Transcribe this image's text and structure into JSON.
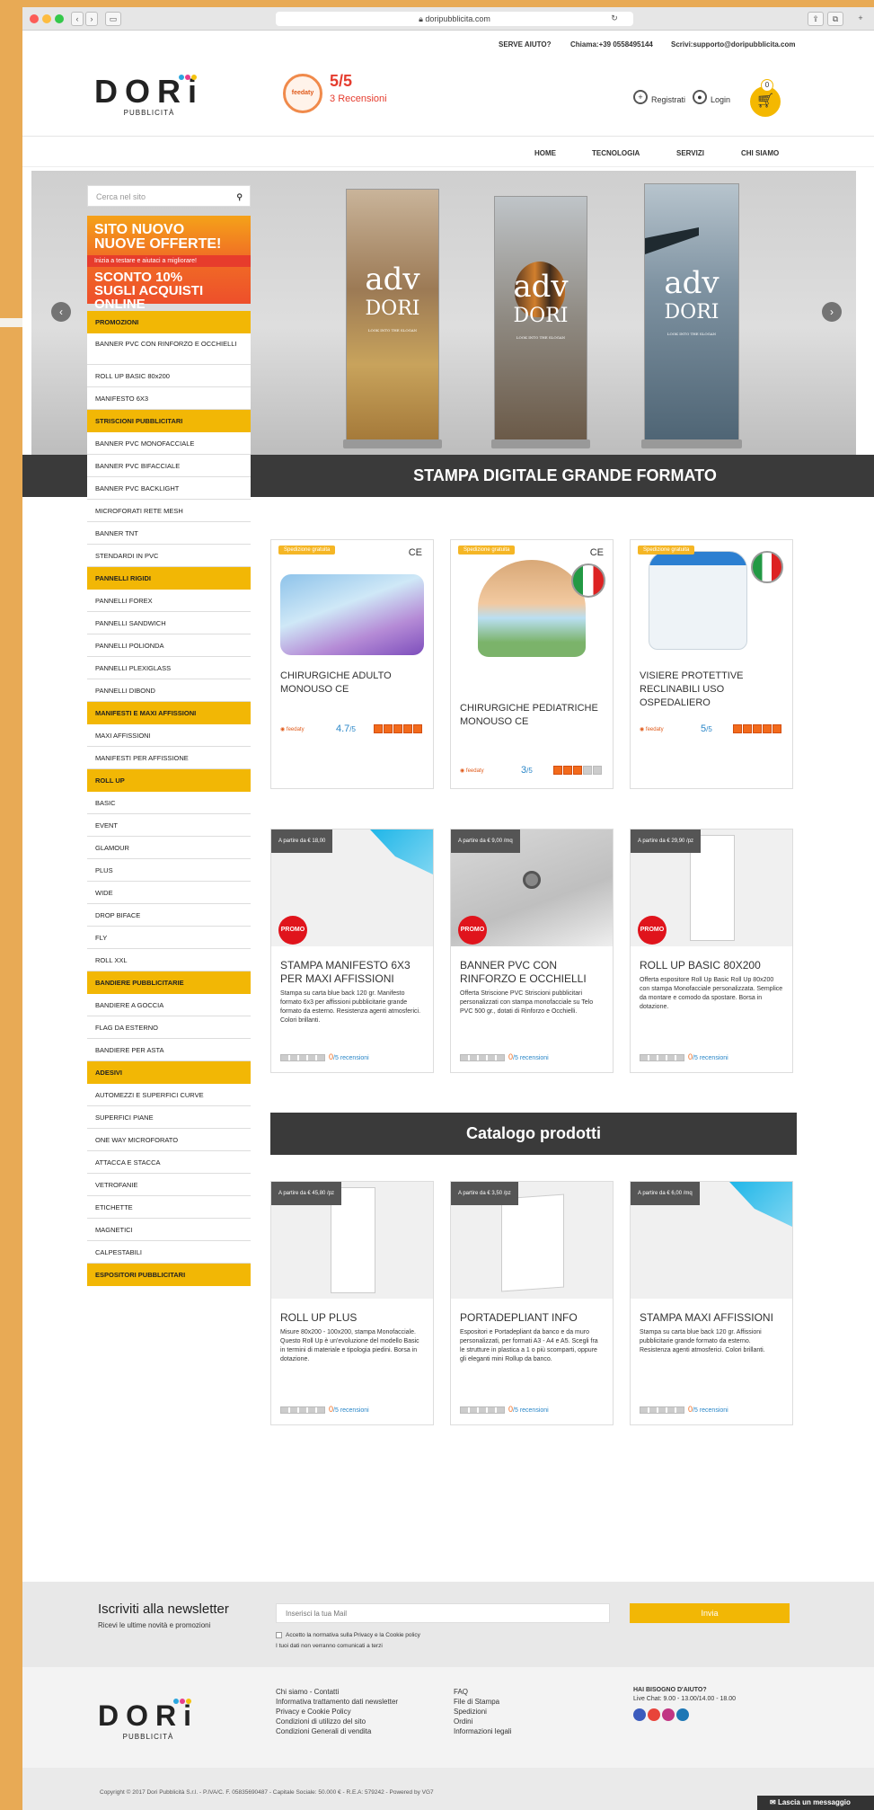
{
  "browser": {
    "url": "doripubblicita.com"
  },
  "topbar": {
    "help": "SERVE AIUTO?",
    "call": "Chiama:+39 0558495144",
    "write": "Scrivi:supporto@doripubblicita.com"
  },
  "brand": {
    "name": "DORi",
    "sub": "PUBBLICITÀ"
  },
  "reviews": {
    "badge": "feedaty",
    "score": "5/5",
    "count": "3",
    "label": "Recensioni"
  },
  "header": {
    "register": "Registrati",
    "login": "Login",
    "cart_count": "0"
  },
  "nav": [
    "HOME",
    "TECNOLOGIA",
    "SERVIZI",
    "CHI SIAMO"
  ],
  "search": {
    "placeholder": "Cerca nel sito"
  },
  "promo": {
    "line1": "SITO NUOVO",
    "line2": "NUOVE OFFERTE!",
    "line3": "Inizia a testare e aiutaci a migliorare!",
    "line4": "SCONTO 10%",
    "line5": "SUGLI ACQUISTI",
    "line6": "ONLINE"
  },
  "banner_text": {
    "adv": "adv",
    "dori": "DORI",
    "tag": "LOOK INTO THE SLOGAN"
  },
  "sidebar": [
    {
      "t": "h",
      "l": "PROMOZIONI"
    },
    {
      "t": "tall",
      "l": "BANNER PVC CON RINFORZO E OCCHIELLI"
    },
    {
      "t": "i",
      "l": "ROLL UP BASIC 80x200"
    },
    {
      "t": "i",
      "l": "MANIFESTO 6X3"
    },
    {
      "t": "h",
      "l": "STRISCIONI PUBBLICITARI"
    },
    {
      "t": "i",
      "l": "BANNER PVC MONOFACCIALE"
    },
    {
      "t": "i",
      "l": "BANNER PVC BIFACCIALE"
    },
    {
      "t": "i",
      "l": "BANNER PVC BACKLIGHT"
    },
    {
      "t": "i",
      "l": "MICROFORATI RETE MESH"
    },
    {
      "t": "i",
      "l": "BANNER TNT"
    },
    {
      "t": "i",
      "l": "STENDARDI IN PVC"
    },
    {
      "t": "h",
      "l": "PANNELLI RIGIDI"
    },
    {
      "t": "i",
      "l": "PANNELLI FOREX"
    },
    {
      "t": "i",
      "l": "PANNELLI SANDWICH"
    },
    {
      "t": "i",
      "l": "PANNELLI POLIONDA"
    },
    {
      "t": "i",
      "l": "PANNELLI PLEXIGLASS"
    },
    {
      "t": "i",
      "l": "PANNELLI DIBOND"
    },
    {
      "t": "h",
      "l": "MANIFESTI E MAXI AFFISSIONI"
    },
    {
      "t": "i",
      "l": "MAXI AFFISSIONI"
    },
    {
      "t": "i",
      "l": "MANIFESTI PER AFFISSIONE"
    },
    {
      "t": "h",
      "l": "ROLL UP"
    },
    {
      "t": "i",
      "l": "BASIC"
    },
    {
      "t": "i",
      "l": "EVENT"
    },
    {
      "t": "i",
      "l": "GLAMOUR"
    },
    {
      "t": "i",
      "l": "PLUS"
    },
    {
      "t": "i",
      "l": "WIDE"
    },
    {
      "t": "i",
      "l": "DROP BIFACE"
    },
    {
      "t": "i",
      "l": "FLY"
    },
    {
      "t": "i",
      "l": "ROLL XXL"
    },
    {
      "t": "h",
      "l": "BANDIERE PUBBLICITARIE"
    },
    {
      "t": "i",
      "l": "BANDIERE A GOCCIA"
    },
    {
      "t": "i",
      "l": "FLAG DA ESTERNO"
    },
    {
      "t": "i",
      "l": "BANDIERE PER ASTA"
    },
    {
      "t": "h",
      "l": "ADESIVI"
    },
    {
      "t": "i",
      "l": "AUTOMEZZI E SUPERFICI CURVE"
    },
    {
      "t": "i",
      "l": "SUPERFICI PIANE"
    },
    {
      "t": "i",
      "l": "ONE WAY MICROFORATO"
    },
    {
      "t": "i",
      "l": "ATTACCA E STACCA"
    },
    {
      "t": "i",
      "l": "VETROFANIE"
    },
    {
      "t": "i",
      "l": "ETICHETTE"
    },
    {
      "t": "i",
      "l": "MAGNETICI"
    },
    {
      "t": "i",
      "l": "CALPESTABILI"
    },
    {
      "t": "h",
      "l": "ESPOSITORI PUBBLICITARI"
    }
  ],
  "section1": {
    "title": "STAMPA DIGITALE GRANDE FORMATO"
  },
  "products1": [
    {
      "tag": "Spedizione gratuita",
      "title": "CHIRURGICHE ADULTO MONOUSO CE",
      "score": "4.7",
      "of": "/5",
      "stars": 5,
      "mark": "CE"
    },
    {
      "tag": "Spedizione gratuita",
      "title": "CHIRURGICHE PEDIATRICHE MONOUSO CE",
      "score": "3",
      "of": "/5",
      "stars": 3,
      "mark": "CE"
    },
    {
      "tag": "Spedizione gratuita",
      "title": "VISIERE PROTETTIVE RECLINABILI USO OSPEDALIERO",
      "score": "5",
      "of": "/5",
      "stars": 5,
      "mark": ""
    }
  ],
  "products2": [
    {
      "price": "A partire da € 18,00",
      "title": "STAMPA MANIFESTO 6X3 PER MAXI AFFISSIONI",
      "desc": "Stampa su carta blue back 120 gr. Manifesto formato 6x3 per affissioni pubblicitarie grande formato da esterno. Resistenza agenti atmosferici. Colori brillanti.",
      "promo": "PROMO"
    },
    {
      "price": "A partire da € 9,00 /mq",
      "title": "BANNER PVC CON RINFORZO E OCCHIELLI",
      "desc": "Offerta Striscione PVC Striscioni pubblicitari personalizzati con stampa monofacciale su Telo PVC 500 gr., dotati di Rinforzo e Occhielli.",
      "promo": "PROMO"
    },
    {
      "price": "A partire da € 29,90 /pz",
      "title": "ROLL UP BASIC 80X200",
      "desc": "Offerta espositore Roll Up Basic Roll Up 80x200 con stampa Monofacciale personalizzata. Semplice da montare e comodo da spostare. Borsa in dotazione.",
      "promo": "PROMO"
    }
  ],
  "section2": {
    "title": "Catalogo prodotti"
  },
  "products3": [
    {
      "price": "A partire da € 45,80 /pz",
      "title": "ROLL UP PLUS",
      "desc": "Misure 80x200 - 100x200, stampa Monofacciale. Questo Roll Up è un'evoluzione del modello Basic in termini di materiale e tipologia piedini. Borsa in dotazione."
    },
    {
      "price": "A partire da € 3,50 /pz",
      "title": "PORTADEPLIANT INFO",
      "desc": "Espositori e Portadepliant da banco e da muro personalizzati, per formati A3 - A4 e A5. Scegli fra le strutture in plastica a 1 o più scomparti, oppure gli eleganti mini Rollup da banco."
    },
    {
      "price": "A partire da € 6,00 /mq",
      "title": "STAMPA MAXI AFFISSIONI",
      "desc": "Stampa su carta blue back 120 gr. Affissioni pubblicitarie grande formato da esterno. Resistenza agenti atmosferici. Colori brillanti."
    }
  ],
  "review_label": {
    "zero": "0",
    "of": "/5",
    "text": "recensioni"
  },
  "newsletter": {
    "title": "Iscriviti alla newsletter",
    "sub": "Ricevi le ultime novità e promozioni",
    "placeholder": "Inserisci la tua Mail",
    "button": "Invia",
    "consent": "Accetto la normativa sulla Privacy e la Cookie policy",
    "note": "I tuoi dati non verranno comunicati a terzi"
  },
  "footer": {
    "col1": [
      "Chi siamo - Contatti",
      "Informativa trattamento dati newsletter",
      "Privacy e Cookie Policy",
      "Condizioni di utilizzo del sito",
      "Condizioni Generali di vendita"
    ],
    "col2": [
      "FAQ",
      "File di Stampa",
      "Spedizioni",
      "Ordini",
      "Informazioni legali"
    ],
    "help_title": "HAI BISOGNO D'AIUTO?",
    "help_hours": "Live Chat: 9.00 - 13.00/14.00 - 18.00"
  },
  "copyright": "Copyright © 2017 Dori Pubblicità S.r.l. - P.IVA/C. F. 05835690487 - Capitale Sociale: 50.000 € - R.E.A: 579242 - Powered by VG7",
  "chat": "Lascia un messaggio",
  "colors": {
    "accent": "#f2b705",
    "dark": "#3a3a3a",
    "rating": "#f26a1b",
    "link": "#2b87c8"
  }
}
